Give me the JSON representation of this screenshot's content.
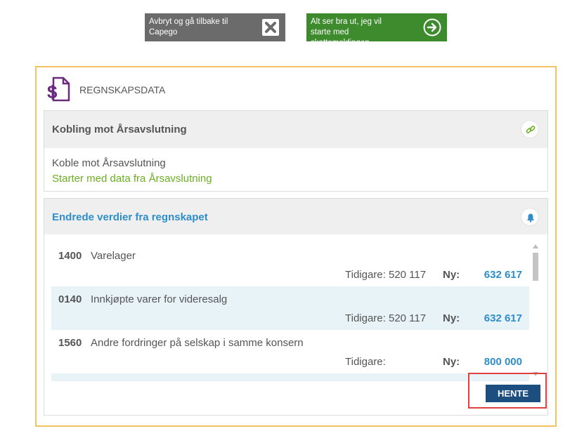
{
  "top_buttons": {
    "cancel_label": "Avbryt og gå tilbake til Capego",
    "continue_label": "Alt ser bra ut, jeg vil starte med skattemeldingen"
  },
  "panel": {
    "title": "REGNSKAPSDATA",
    "connection": {
      "heading": "Kobling mot Årsavslutning",
      "line1": "Koble mot Årsavslutning",
      "line2": "Starter med data fra Årsavslutning"
    },
    "changes": {
      "heading": "Endrede verdier fra regnskapet",
      "rows": [
        {
          "account": "1400",
          "name": "Varelager",
          "previous": "Tidigare: 520 117",
          "new_label": "Ny:",
          "new_value": "632 617"
        },
        {
          "account": "0140",
          "name": "Innkjøpte varer for videresalg",
          "previous": "Tidigare: 520 117",
          "new_label": "Ny:",
          "new_value": "632 617"
        },
        {
          "account": "1560",
          "name": "Andre fordringer på selskap i samme konsern",
          "previous": "Tidigare:",
          "new_label": "Ny:",
          "new_value": "800 000"
        }
      ],
      "fetch_label": "HENTE"
    }
  },
  "colors": {
    "accent_blue": "#2e8ec9",
    "green": "#6aaf22",
    "panel_border": "#f2c160",
    "highlight_red": "#e04040",
    "fetch_button": "#1c4e80"
  }
}
